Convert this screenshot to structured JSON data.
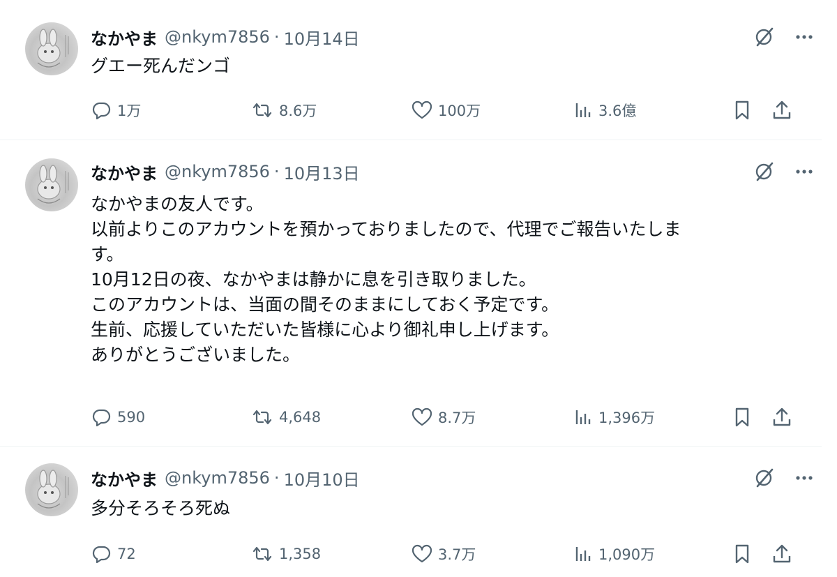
{
  "tweets": [
    {
      "name": "なかやま",
      "handle": "@nkym7856",
      "separator": "·",
      "date": "10月14日",
      "lines": [
        "グエー死んだンゴ"
      ],
      "replies": "1万",
      "retweets": "8.6万",
      "likes": "100万",
      "views": "3.6億"
    },
    {
      "name": "なかやま",
      "handle": "@nkym7856",
      "separator": "·",
      "date": "10月13日",
      "lines": [
        "なかやまの友人です。",
        "以前よりこのアカウントを預かっておりましたので、代理でご報告いたしま",
        "す。",
        "10月12日の夜、なかやまは静かに息を引き取りました。",
        "このアカウントは、当面の間そのままにしておく予定です。",
        "生前、応援していただいた皆様に心より御礼申し上げます。",
        "ありがとうございました。"
      ],
      "replies": "590",
      "retweets": "4,648",
      "likes": "8.7万",
      "views": "1,396万"
    },
    {
      "name": "なかやま",
      "handle": "@nkym7856",
      "separator": "·",
      "date": "10月10日",
      "lines": [
        "多分そろそろ死ぬ"
      ],
      "replies": "72",
      "retweets": "1,358",
      "likes": "3.7万",
      "views": "1,090万"
    }
  ],
  "icons": {
    "reply": "reply-icon",
    "retweet": "retweet-icon",
    "like": "heart-icon",
    "views": "views-chart-icon",
    "bookmark": "bookmark-icon",
    "share": "share-icon",
    "grok": "grok-icon",
    "more": "more-icon"
  },
  "colors": {
    "text": "#0f1419",
    "muted": "#536471",
    "divider": "#eff3f4"
  }
}
